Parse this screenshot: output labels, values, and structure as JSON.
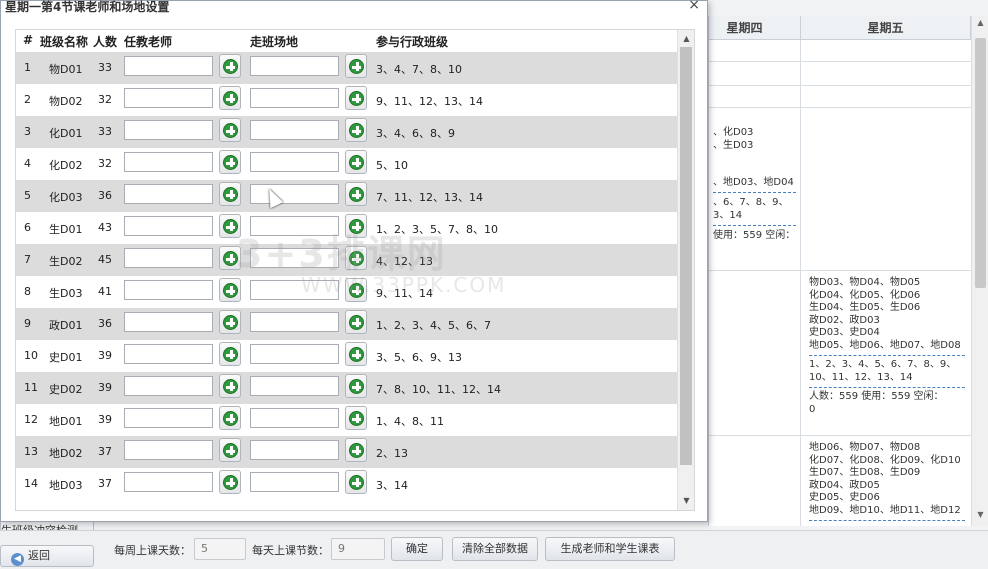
{
  "dialog": {
    "title": "星期一第4节课老师和场地设置",
    "close": "×",
    "columns": [
      "#",
      "班级名称",
      "人数",
      "任教老师",
      "走班场地",
      "参与行政班级"
    ],
    "rows": [
      {
        "n": "1",
        "cls": "物D01",
        "count": "33",
        "admin": "3、4、7、8、10"
      },
      {
        "n": "2",
        "cls": "物D02",
        "count": "32",
        "admin": "9、11、12、13、14"
      },
      {
        "n": "3",
        "cls": "化D01",
        "count": "33",
        "admin": "3、4、6、8、9"
      },
      {
        "n": "4",
        "cls": "化D02",
        "count": "32",
        "admin": "5、10"
      },
      {
        "n": "5",
        "cls": "化D03",
        "count": "36",
        "admin": "7、11、12、13、14"
      },
      {
        "n": "6",
        "cls": "生D01",
        "count": "43",
        "admin": "1、2、3、5、7、8、10"
      },
      {
        "n": "7",
        "cls": "生D02",
        "count": "45",
        "admin": "4、12、13"
      },
      {
        "n": "8",
        "cls": "生D03",
        "count": "41",
        "admin": "9、11、14"
      },
      {
        "n": "9",
        "cls": "政D01",
        "count": "36",
        "admin": "1、2、3、4、5、6、7"
      },
      {
        "n": "10",
        "cls": "史D01",
        "count": "39",
        "admin": "3、5、6、9、13"
      },
      {
        "n": "11",
        "cls": "史D02",
        "count": "39",
        "admin": "7、8、10、11、12、14"
      },
      {
        "n": "12",
        "cls": "地D01",
        "count": "39",
        "admin": "1、4、8、11"
      },
      {
        "n": "13",
        "cls": "地D02",
        "count": "37",
        "admin": "2、13"
      },
      {
        "n": "14",
        "cls": "地D03",
        "count": "37",
        "admin": "3、14"
      }
    ]
  },
  "background": {
    "headers": [
      "星期四",
      "星期五"
    ],
    "row3_col4": [
      "、化D03",
      "、生D03",
      "",
      "",
      "、地D03、地D04",
      "",
      "、6、7、8、9、",
      "3、14",
      "",
      "使用：559  空闲："
    ],
    "row4_col5": [
      "物D03、物D04、物D05",
      "化D04、化D05、化D06",
      "生D04、生D05、生D06",
      "政D02、政D03",
      "史D03、史D04",
      "地D05、地D06、地D07、地D08"
    ],
    "row4_col5_nums": [
      "1、2、3、4、5、6、7、8、9、",
      "10、11、12、13、14"
    ],
    "row4_col5_stats": [
      "人数：559  使用：559  空闲：",
      "0"
    ],
    "row5_col5": [
      "地D06、物D07、物D08",
      "化D07、化D08、化D09、化D10",
      "生D07、生D08、生D09",
      "政D04、政D05",
      "史D05、史D06",
      "地D09、地D10、地D11、地D12"
    ]
  },
  "sidebar": {
    "conflict_check": "生班级冲突检测",
    "back": "返回",
    "back_icon": "back-arrow-icon"
  },
  "bottom_bar": {
    "days_label": "每周上课天数：",
    "days_value": "5",
    "periods_label": "每天上课节数：",
    "periods_value": "9",
    "confirm": "确定",
    "clear_all": "清除全部数据",
    "generate": "生成老师和学生课表"
  },
  "watermark": {
    "main": "3+3排课网",
    "url": "WWW.33PPK.COM"
  },
  "colors": {
    "alt_row": "#dcdcdc",
    "plus_green": "#2f9a3c",
    "dash_blue": "#4a7fc1"
  }
}
